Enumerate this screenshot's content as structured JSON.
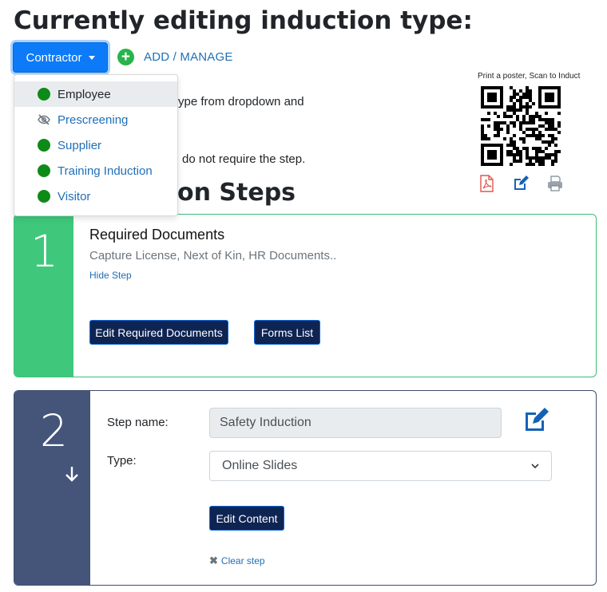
{
  "page": {
    "title": "Currently editing induction type:",
    "section_heading": "on Steps"
  },
  "type_selector": {
    "selected": "Contractor",
    "add_manage_label": "ADD / MANAGE",
    "items": [
      {
        "label": "Employee",
        "icon": "status-dot-icon",
        "active": true
      },
      {
        "label": "Prescreening",
        "icon": "eye-slash-icon",
        "active": false
      },
      {
        "label": "Supplier",
        "icon": "status-dot-icon",
        "active": false
      },
      {
        "label": "Training Induction",
        "icon": "status-dot-icon",
        "active": false
      },
      {
        "label": "Visitor",
        "icon": "status-dot-icon",
        "active": false
      }
    ]
  },
  "instructions": {
    "line1_fragment": "ype from dropdown and",
    "line2_fragment": "do not require the step."
  },
  "qr": {
    "caption": "Print a poster, Scan to Induct",
    "actions": [
      "pdf-icon",
      "edit-icon",
      "print-icon"
    ]
  },
  "steps": [
    {
      "number": "1",
      "title": "Required Documents",
      "description": "Capture License, Next of Kin, HR Documents..",
      "hide_label": "Hide Step",
      "buttons": [
        "Edit Required Documents",
        "Forms List"
      ]
    },
    {
      "number": "2",
      "name_label": "Step name:",
      "name_value": "Safety Induction",
      "type_label": "Type:",
      "type_value": "Online Slides",
      "edit_content_label": "Edit Content",
      "clear_label": "Clear step"
    }
  ],
  "colors": {
    "primary_button": "#0d7bf7",
    "link": "#1f6fb8",
    "navy_button": "#0e2453",
    "step1_accent": "#3fc87c",
    "step2_accent": "#45557a",
    "status_green": "#0d8a17"
  }
}
